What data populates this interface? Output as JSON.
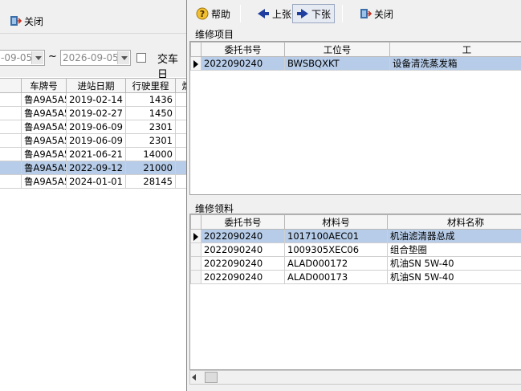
{
  "left": {
    "close_label": "关闭",
    "date_from": "-09-05",
    "date_sep": "~",
    "date_to": "2026-09-05",
    "deliver_label": "交车日",
    "columns": [
      "车牌号",
      "进站日期",
      "行驶里程",
      "燃"
    ],
    "rows": [
      {
        "plate": "鲁A9A5A5",
        "date": "2019-02-14",
        "mileage": "1436"
      },
      {
        "plate": "鲁A9A5A5",
        "date": "2019-02-27",
        "mileage": "1450"
      },
      {
        "plate": "鲁A9A5A5",
        "date": "2019-06-09",
        "mileage": "2301"
      },
      {
        "plate": "鲁A9A5A5",
        "date": "2019-06-09",
        "mileage": "2301"
      },
      {
        "plate": "鲁A9A5A5",
        "date": "2021-06-21",
        "mileage": "14000"
      },
      {
        "plate": "鲁A9A5A5",
        "date": "2022-09-12",
        "mileage": "21000"
      },
      {
        "plate": "鲁A9A5A5",
        "date": "2024-01-01",
        "mileage": "28145"
      }
    ],
    "selected_row": 5
  },
  "right": {
    "toolbar": {
      "help": "帮助",
      "prev": "上张",
      "next": "下张",
      "close": "关闭"
    },
    "items_title": "维修项目",
    "items_columns": [
      "委托书号",
      "工位号",
      "工"
    ],
    "items_rows": [
      {
        "order": "2022090240",
        "station": "BWSBQXKT",
        "name": "设备清洗蒸发箱"
      }
    ],
    "materials_title": "维修领料",
    "materials_columns": [
      "委托书号",
      "材料号",
      "材料名称"
    ],
    "materials_rows": [
      {
        "order": "2022090240",
        "code": "1017100AEC01",
        "name": "机油滤清器总成"
      },
      {
        "order": "2022090240",
        "code": "1009305XEC06",
        "name": "组合垫圈"
      },
      {
        "order": "2022090240",
        "code": "ALAD000172",
        "name": "机油SN 5W-40"
      },
      {
        "order": "2022090240",
        "code": "ALAD000173",
        "name": "机油SN 5W-40"
      }
    ]
  },
  "colors": {
    "selection": "#b6cce8",
    "arrow_blue": "#1f3fa0"
  }
}
